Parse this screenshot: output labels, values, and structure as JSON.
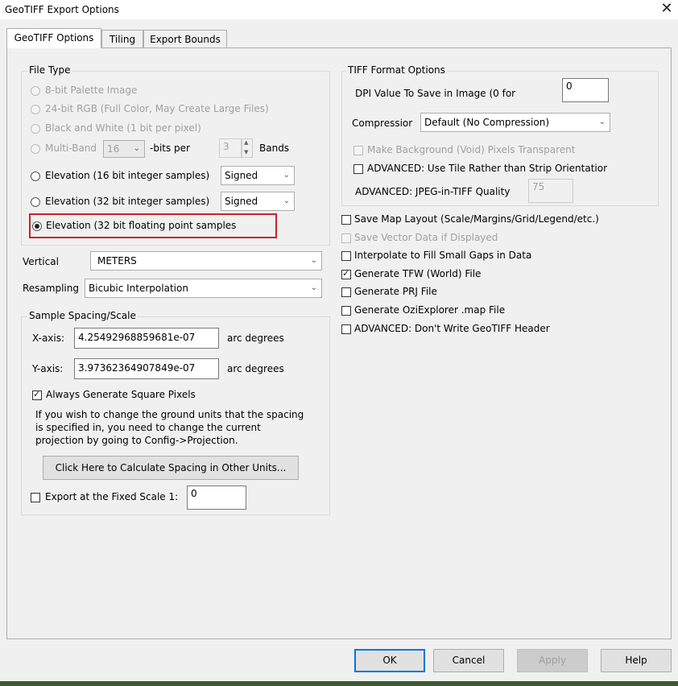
{
  "window": {
    "title": "GeoTIFF Export Options",
    "close_glyph": "✕"
  },
  "tabs": [
    {
      "label": "GeoTIFF Options",
      "active": true
    },
    {
      "label": "Tiling",
      "active": false
    },
    {
      "label": "Export Bounds",
      "active": false
    }
  ],
  "file_type": {
    "title": "File Type",
    "options": [
      "8-bit Palette Image",
      "24-bit RGB (Full Color, May Create Large Files)",
      "Black and White (1 bit per pixel)"
    ],
    "multiband": {
      "label": "Multi-Band",
      "bits_value": "16",
      "bits_per_label": "-bits per",
      "bands_value": "3",
      "bands_label": "Bands"
    },
    "elev16": {
      "label": "Elevation (16 bit integer samples)",
      "sign": "Signed"
    },
    "elev32": {
      "label": "Elevation (32 bit integer samples)",
      "sign": "Signed"
    },
    "elev32f": {
      "label": "Elevation (32 bit floating point samples"
    }
  },
  "vertical": {
    "label": "Vertical",
    "value": "METERS"
  },
  "resampling": {
    "label": "Resampling",
    "value": "Bicubic Interpolation"
  },
  "sample_spacing": {
    "title": "Sample Spacing/Scale",
    "x_label": "X-axis:",
    "x_value": "4.25492968859681e-07",
    "x_units": "arc degrees",
    "y_label": "Y-axis:",
    "y_value": "3.97362364907849e-07",
    "y_units": "arc degrees",
    "square_pixels_label": "Always Generate Square Pixels",
    "note_1": "If you wish to change the ground units that the spacing",
    "note_2": "is specified in, you need to change the current",
    "note_3": "projection by going to Config->Projection.",
    "calc_button": "Click Here to Calculate Spacing in Other Units..."
  },
  "fixed_scale": {
    "label": "Export at the Fixed Scale 1:",
    "value": "0"
  },
  "tiff_format": {
    "title": "TIFF Format Options",
    "dpi_label": "DPI Value To Save in Image (0 for",
    "dpi_value": "0",
    "compression_label": "Compressior",
    "compression_value": "Default (No Compression)",
    "transparent_label": "Make Background (Void) Pixels Transparent",
    "tile_label": "ADVANCED: Use Tile Rather than Strip Orientatior",
    "jpeg_label": "ADVANCED: JPEG-in-TIFF Quality",
    "jpeg_value": "75"
  },
  "right_checks": [
    {
      "label": "Save Map Layout (Scale/Margins/Grid/Legend/etc.)",
      "checked": false,
      "disabled": false
    },
    {
      "label": "Save Vector Data if Displayed",
      "checked": false,
      "disabled": true
    },
    {
      "label": "Interpolate to Fill Small Gaps in Data",
      "checked": false,
      "disabled": false
    },
    {
      "label": "Generate TFW (World) File",
      "checked": true,
      "disabled": false
    },
    {
      "label": "Generate PRJ File",
      "checked": false,
      "disabled": false
    },
    {
      "label": "Generate OziExplorer .map File",
      "checked": false,
      "disabled": false
    },
    {
      "label": "ADVANCED: Don't Write GeoTIFF Header",
      "checked": false,
      "disabled": false
    }
  ],
  "buttons": {
    "ok": "OK",
    "cancel": "Cancel",
    "apply": "Apply",
    "help": "Help"
  },
  "icons": {
    "dropdown": "chevron-down-icon",
    "spin_up": "▲",
    "spin_down": "▼"
  },
  "colors": {
    "highlight": "#c8232c",
    "focus": "#0078d7"
  }
}
